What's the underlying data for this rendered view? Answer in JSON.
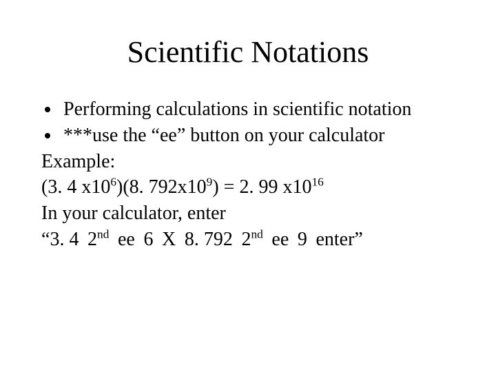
{
  "title": "Scientific Notations",
  "bullets": [
    "Performing calculations in scientific notation",
    "***use the “ee” button on your calculator"
  ],
  "lines": {
    "example_label": "Example:",
    "expr": {
      "a_base": "(3. 4 x10",
      "a_exp": "6",
      "mid": ")(8. 792x10",
      "b_exp": "9",
      "after": ") = 2. 99 x10",
      "r_exp": "16"
    },
    "calc_intro": "In your calculator, enter",
    "seq": {
      "open_quote": "“",
      "t1": "3. 4",
      "t2_base": "2",
      "t2_sup": "nd",
      "t3": "ee",
      "t4": "6",
      "t5": "X",
      "t6": "8. 792",
      "t7_base": "2",
      "t7_sup": "nd",
      "t8": "ee",
      "t9": "9",
      "t10": "enter",
      "close_quote": "”"
    }
  }
}
